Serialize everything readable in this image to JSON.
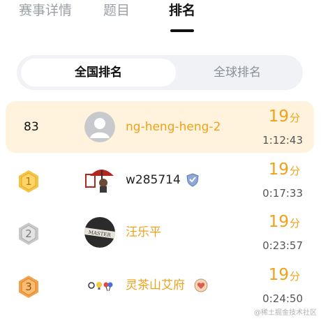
{
  "tabs": [
    {
      "label": "赛事详情",
      "active": false
    },
    {
      "label": "题目",
      "active": false
    },
    {
      "label": "排名",
      "active": true
    }
  ],
  "segment": {
    "active_label": "全国排名",
    "inactive_label": "全球排名"
  },
  "colors": {
    "accent": "#f0a11a",
    "highlight_row_bg": "#fff3dd",
    "gold_medal": "#f6c343",
    "silver_medal": "#c9c9c9",
    "bronze_medal": "#f2a24b"
  },
  "my_rank": {
    "rank": "83",
    "name": "ng-heng-heng-2",
    "score": "19",
    "score_unit": "分",
    "time": "1:12:43",
    "avatar": "default-avatar-icon"
  },
  "ranking": [
    {
      "rank": "1",
      "medal": "gold",
      "name": "w285714",
      "has_badge": true,
      "score": "19",
      "score_unit": "分",
      "time": "0:17:33",
      "avatar": "red-umbrella-avatar"
    },
    {
      "rank": "2",
      "medal": "silver",
      "name": "汪乐平",
      "has_badge": false,
      "score": "19",
      "score_unit": "分",
      "time": "0:23:57",
      "avatar": "master-avatar"
    },
    {
      "rank": "3",
      "medal": "bronze",
      "name": "灵茶山艾府",
      "has_badge": true,
      "score": "19",
      "score_unit": "分",
      "time": "0:24:50",
      "avatar": "emoji-avatar"
    }
  ],
  "watermark": "@稀土掘金技术社区"
}
